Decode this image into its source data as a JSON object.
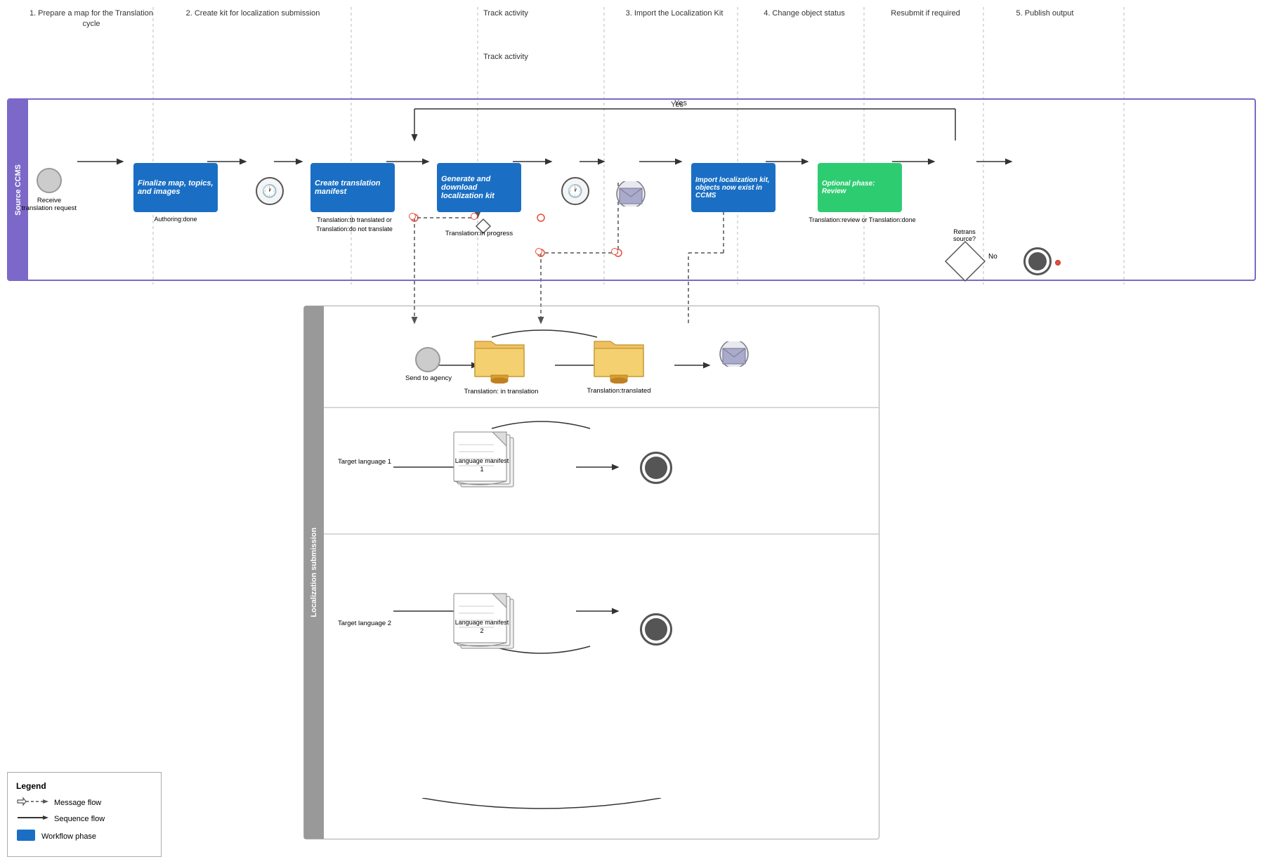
{
  "phases": [
    {
      "id": "phase1",
      "label": "1. Prepare a map for\nthe Translation cycle"
    },
    {
      "id": "phase2",
      "label": "2. Create kit for localization submission"
    },
    {
      "id": "phase3",
      "label": "Track activity"
    },
    {
      "id": "phase4",
      "label": "3. Import the\nLocalization Kit"
    },
    {
      "id": "phase5",
      "label": "4. Change object\nstatus"
    },
    {
      "id": "phase6",
      "label": "Resubmit\nif required"
    },
    {
      "id": "phase7",
      "label": "5. Publish\noutput"
    }
  ],
  "swimlane": {
    "label": "Source CCMS"
  },
  "nodes": {
    "receive": "Receive\ntranslation\nrequest",
    "finalize": "Finalize map,\ntopics, and\nimages",
    "createManifest": "Create translation\nmanifest",
    "generateKit": "Generate and\ndownload\nlocalization kit",
    "importKit": "Import localization\nkit, objects now\nexist in CCMS",
    "optionalReview": "Optional phase:\nReview",
    "retrans": "Retrans\nsource?"
  },
  "labels": {
    "authoringDone": "Authoring:done",
    "translationTb": "Translation:tb translated\nor\nTranslation:do not translate",
    "translationInProgress": "Translation:in progress",
    "translationReview": "Translation:review\nor\nTranslation:done",
    "yes": "Yes",
    "no": "No",
    "trackActivity": "Track activity",
    "sendToAgency": "Send\nto\nagency",
    "translationInTranslation": "Translation:\nin translation",
    "translationTranslated": "Translation:translated",
    "targetLang1": "Target\nlanguage 1",
    "targetLang2": "Target\nlanguage 2",
    "langManifest1": "Language\nmanifest 1",
    "langManifest2": "Language\nmanifest 2",
    "locSubmission": "Localization submission"
  },
  "legend": {
    "title": "Legend",
    "items": [
      {
        "icon": "message-flow-icon",
        "label": "Message flow"
      },
      {
        "icon": "sequence-flow-icon",
        "label": "Sequence flow"
      },
      {
        "icon": "workflow-phase-icon",
        "label": "Workflow phase"
      }
    ]
  }
}
